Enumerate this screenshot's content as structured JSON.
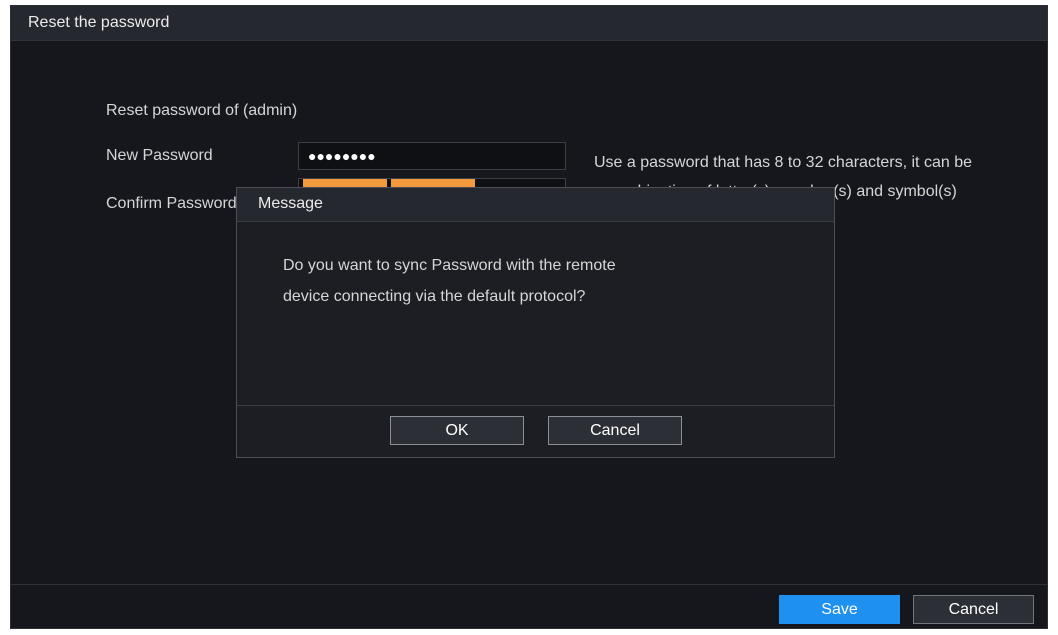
{
  "window": {
    "title": "Reset the password"
  },
  "form": {
    "reset_label": "Reset password of (admin)",
    "new_password_label": "New Password",
    "new_password_value": "●●●●●●●●",
    "confirm_password_label": "Confirm Password",
    "hint_text": "Use a password that has 8 to 32 characters, it can be a combination of letter(s), number(s) and symbol(s) with at least two kinds of them."
  },
  "modal": {
    "title": "Message",
    "message_line1": "Do you want to sync Password with the remote",
    "message_line2": "device connecting via the default protocol?",
    "ok_label": "OK",
    "cancel_label": "Cancel"
  },
  "footer": {
    "save_label": "Save",
    "cancel_label": "Cancel"
  },
  "colors": {
    "accent": "#1e90f0",
    "strength_bar": "#f29a3d",
    "background": "#15171c"
  }
}
